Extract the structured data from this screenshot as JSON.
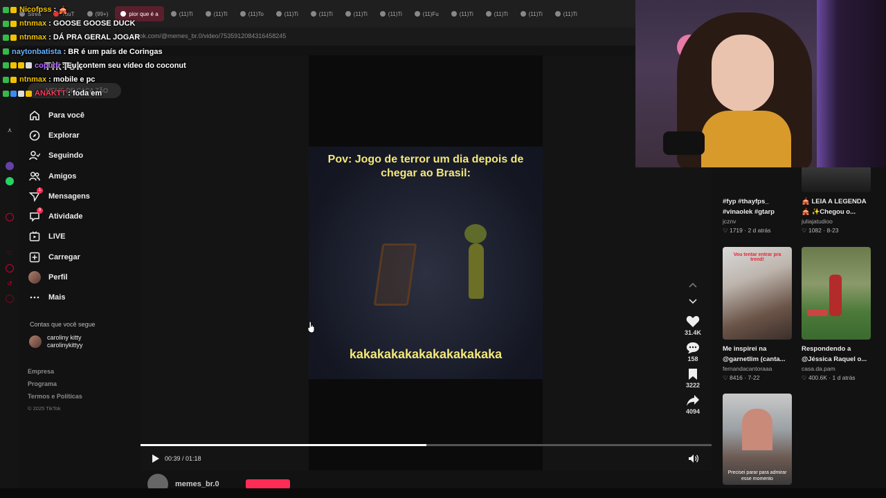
{
  "browser": {
    "tabs": [
      "Strea",
      "YouT",
      "(99+)",
      "pior que é a",
      "(11)Ti",
      "(11)Ti",
      "(11)To",
      "(11)Ti",
      "(11)Ti",
      "(11)Ti",
      "(11)Ti",
      "(11)Fu",
      "(11)Ti",
      "(11)Ti",
      "(11)Ti",
      "(11)Ti"
    ],
    "active_tab": 3,
    "url": "tiktok.com/@memes_br.0/video/7535912084316458245"
  },
  "chat": [
    {
      "user": "Nicofpss",
      "color": "#f2c200",
      "message": "🎪"
    },
    {
      "user": "ntnmax",
      "color": "#f2c200",
      "message": "GOOSE GOOSE DUCK"
    },
    {
      "user": "ntnmax",
      "color": "#f2c200",
      "message": "DÁ PRA GERAL JOGAR"
    },
    {
      "user": "naytonbatista",
      "color": "#6ab0ff",
      "message": "BR é um país de Coringas"
    },
    {
      "user": "coputti",
      "color": "#b46bff",
      "message": "Eu contem seu vídeo do coconut"
    },
    {
      "user": "ntnmax",
      "color": "#f2c200",
      "message": "mobile e pc"
    },
    {
      "user": "ANAKTT",
      "color": "#ff3b5c",
      "message": "foda em"
    }
  ],
  "sidebar": {
    "logo": "TikTok",
    "search_placeholder": "MEME DE CAÇA ZÃO",
    "items": [
      {
        "label": "Para você",
        "icon": "home-icon"
      },
      {
        "label": "Explorar",
        "icon": "compass-icon"
      },
      {
        "label": "Seguindo",
        "icon": "following-icon"
      },
      {
        "label": "Amigos",
        "icon": "friends-icon"
      },
      {
        "label": "Mensagens",
        "icon": "messages-icon",
        "badge": "1"
      },
      {
        "label": "Atividade",
        "icon": "activity-icon",
        "badge": "9"
      },
      {
        "label": "LIVE",
        "icon": "live-icon"
      },
      {
        "label": "Carregar",
        "icon": "upload-icon"
      },
      {
        "label": "Perfil",
        "icon": "profile-avatar"
      },
      {
        "label": "Mais",
        "icon": "more-icon"
      }
    ],
    "following_title": "Contas que você segue",
    "following": {
      "name": "caroliny kitty",
      "handle": "carolinykittyy"
    },
    "footer": [
      "Empresa",
      "Programa",
      "Termos e Políticas"
    ],
    "copyright": "© 2025 TikTok"
  },
  "video": {
    "caption_top": "Pov: Jogo de terror um dia depois de chegar ao Brasil:",
    "caption_bottom": "kakakakakakakakakakaka",
    "time": "00:39 / 01:18",
    "progress": 0.5,
    "author": "memes_br.0"
  },
  "actions": {
    "likes": "31.4K",
    "comments": "158",
    "saves": "3222",
    "shares": "4094"
  },
  "related": [
    {
      "title1": "#fyp #thayfps_",
      "title2": "#vinaolek #gtarp",
      "user": "jcznv",
      "meta": "♡ 1719 · 2 d atrás"
    },
    {
      "title1": "🎪 LEIA A LEGENDA",
      "title2": "🎪 ✨Chegou o...",
      "user": "juliajatudioo",
      "meta": "♡ 1082 · 8-23"
    },
    {
      "title1": "Me inspirei na",
      "title2": "@garnetlim (canta...",
      "user": "fernandacantoraaa",
      "meta": "♡ 8416 · 7-22",
      "overlay": "Vou tentar entrar pra trend!"
    },
    {
      "title1": "Respondendo a",
      "title2": "@Jéssica Raquel o...",
      "user": "casa.da.pam",
      "meta": "♡ 400.6K · 1 d atrás"
    },
    {
      "overlay": "Precisei parar para admirar esse momento"
    }
  ]
}
